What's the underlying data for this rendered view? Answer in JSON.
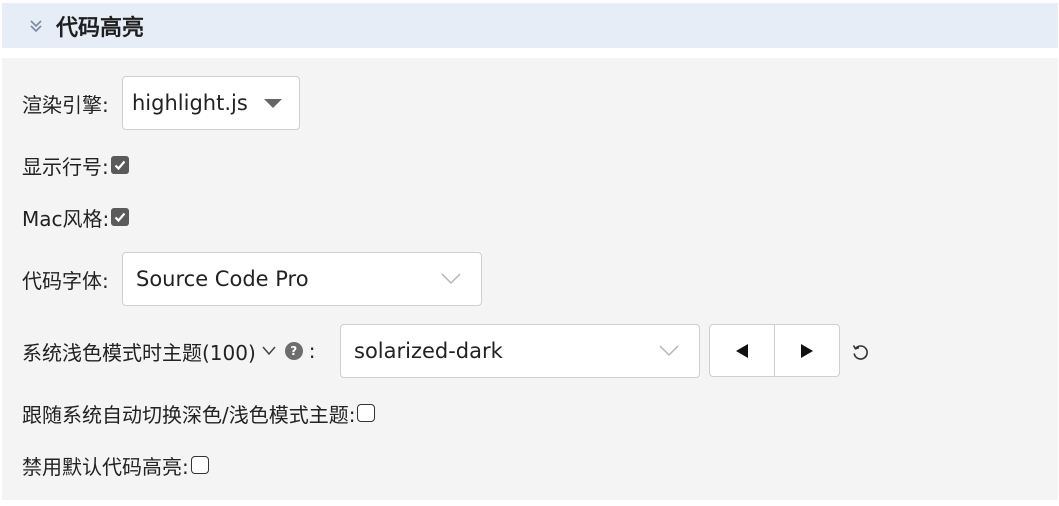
{
  "section": {
    "title": "代码高亮",
    "icon": "double-chevron-down-icon"
  },
  "engine": {
    "label": "渲染引擎:",
    "value": "highlight.js"
  },
  "line_numbers": {
    "label": "显示行号:",
    "checked": true
  },
  "mac_style": {
    "label": "Mac风格:",
    "checked": true
  },
  "code_font": {
    "label": "代码字体:",
    "value": "Source Code Pro"
  },
  "light_theme": {
    "label": "系统浅色模式时主题(100)",
    "colon": ":",
    "value": "solarized-dark",
    "help_glyph": "?"
  },
  "follow_system": {
    "label": "跟随系统自动切换深色/浅色模式主题:",
    "checked": false
  },
  "disable_default": {
    "label": "禁用默认代码高亮:",
    "checked": false
  },
  "colors": {
    "header_bg": "#e6edf7",
    "panel_bg": "#f4f4f4",
    "checkbox_on": "#5a5a5a"
  }
}
